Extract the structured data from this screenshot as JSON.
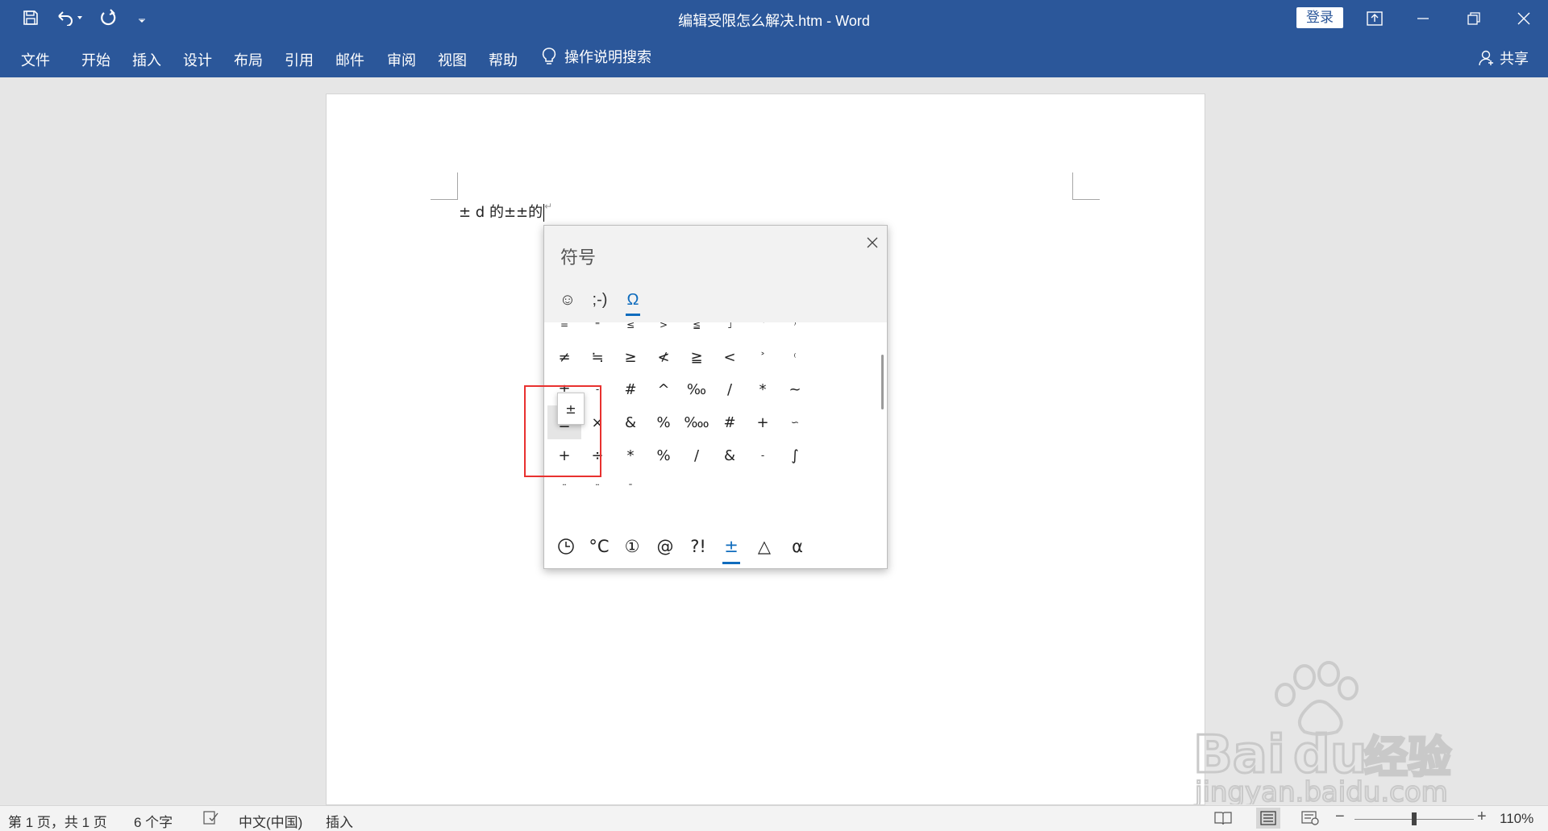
{
  "window": {
    "title": "编辑受限怎么解决.htm  -  Word",
    "login_label": "登录"
  },
  "ribbon": {
    "tabs": [
      "文件",
      "开始",
      "插入",
      "设计",
      "布局",
      "引用",
      "邮件",
      "审阅",
      "视图",
      "帮助"
    ],
    "tell_me": "操作说明搜索",
    "share": "共享"
  },
  "document": {
    "text": "± d 的±±的"
  },
  "symbol_panel": {
    "title": "符号",
    "category_tabs": [
      "☺",
      ";-)",
      "Ω"
    ],
    "active_category": 2,
    "rows": [
      [
        "=",
        "⁼",
        "≤",
        ">",
        "≦",
        "˩",
        "˂",
        "⁾"
      ],
      [
        "≠",
        "≒",
        "≥",
        "≮",
        "≧",
        "<",
        "˃",
        "⁽"
      ],
      [
        "±",
        "-",
        "#",
        "^",
        "‰",
        "/",
        "*",
        "~"
      ],
      [
        "±",
        "×",
        "&",
        "%",
        "‱",
        "#",
        "+",
        "∽"
      ],
      [
        "+",
        "÷",
        "*",
        "%",
        "/",
        "&",
        "-",
        "∫"
      ],
      [
        "¨",
        "¨",
        "¯",
        "",
        "",
        "",
        "",
        ""
      ]
    ],
    "hovered_symbol": "±",
    "footer_tabs": [
      "🕒",
      "°C",
      "①",
      "@",
      "?!",
      "±",
      "△",
      "α"
    ],
    "active_footer": 5
  },
  "statusbar": {
    "page_info": "第 1 页，共 1 页",
    "word_count": "6 个字",
    "language": "中文(中国)",
    "mode": "插入",
    "zoom": "110%",
    "zoom_minus": "−",
    "zoom_plus": "+"
  },
  "watermark": {
    "brand": "Baidu经验",
    "url": "jingyan.baidu.com"
  },
  "colors": {
    "title_bar": "#2b579a",
    "accent": "#0f6cbd",
    "highlight": "#e8312f"
  }
}
